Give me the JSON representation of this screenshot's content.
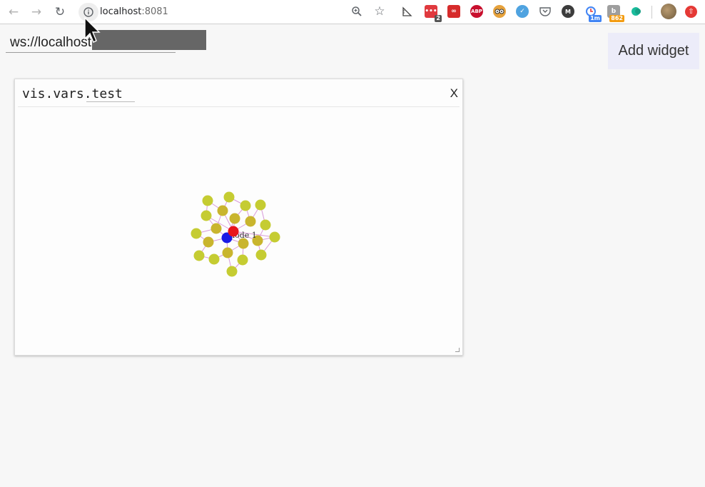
{
  "browser": {
    "url_host": "localhost",
    "url_port": ":8081",
    "toolbar_icons": [
      {
        "name": "zoom-icon"
      },
      {
        "name": "bookmark-star-icon"
      },
      {
        "name": "ruler-extension-icon"
      },
      {
        "name": "meetup-extension-icon",
        "badge": "2"
      },
      {
        "name": "mendeley-extension-icon"
      },
      {
        "name": "adblock-plus-icon",
        "label": "ABP"
      },
      {
        "name": "owl-extension-icon"
      },
      {
        "name": "checkmark-extension-icon"
      },
      {
        "name": "pocket-icon"
      },
      {
        "name": "m-extension-icon",
        "label": "M"
      },
      {
        "name": "timer-extension-icon",
        "badge": "1m"
      },
      {
        "name": "bookmark-extension-icon",
        "badge": "862"
      },
      {
        "name": "leaf-extension-icon"
      }
    ]
  },
  "connection": {
    "url_value": "ws://localhost"
  },
  "actions": {
    "add_widget_label": "Add widget"
  },
  "widget": {
    "title": "vis.vars.test",
    "close_label": "X"
  },
  "graph": {
    "node_label": "node 1",
    "colors": {
      "default_node": "#c5cc32",
      "alt_node": "#c9b52e",
      "highlight_node": "#e8141c",
      "selected_node": "#1a1ae6",
      "edge": "#d99ad9"
    }
  }
}
